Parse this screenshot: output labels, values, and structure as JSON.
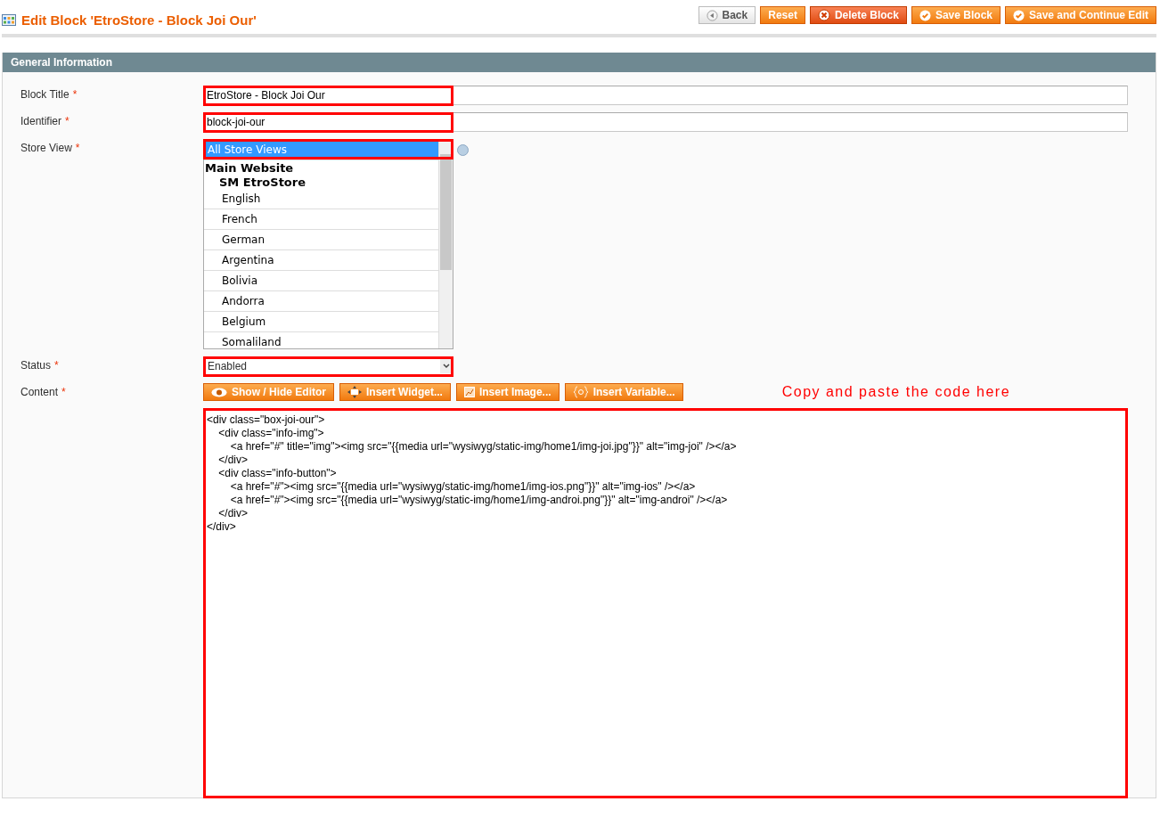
{
  "page_title": "Edit Block 'EtroStore - Block Joi Our'",
  "actions": [
    {
      "label": "Back",
      "kind": "back"
    },
    {
      "label": "Reset",
      "kind": "plain"
    },
    {
      "label": "Delete Block",
      "kind": "delete"
    },
    {
      "label": "Save Block",
      "kind": "save"
    },
    {
      "label": "Save and Continue Edit",
      "kind": "save"
    }
  ],
  "section": {
    "title": "General Information"
  },
  "fields": [
    {
      "label": "Block Title",
      "required_mark": "*",
      "kind": "text",
      "value": "EtroStore - Block Joi Our",
      "highlight": true
    },
    {
      "label": "Identifier",
      "required_mark": "*",
      "kind": "text",
      "value": "block-joi-our",
      "highlight": true
    },
    {
      "label": "Store View",
      "required_mark": "*",
      "kind": "multiselect",
      "highlight": true,
      "options": [
        {
          "label": "All Store Views",
          "selected": true
        },
        {
          "label": "Main Website",
          "kind": "group",
          "children": [
            {
              "label": "SM EtroStore",
              "kind": "group",
              "children": [
                {
                  "label": "English",
                  "selected": false
                },
                {
                  "label": "French",
                  "selected": false
                },
                {
                  "label": "German",
                  "selected": false
                },
                {
                  "label": "Argentina",
                  "selected": false
                },
                {
                  "label": "Bolivia",
                  "selected": false
                },
                {
                  "label": "Andorra",
                  "selected": false
                },
                {
                  "label": "Belgium",
                  "selected": false
                },
                {
                  "label": "Somaliland",
                  "selected": false
                }
              ]
            }
          ]
        }
      ]
    },
    {
      "label": "Status",
      "required_mark": "*",
      "kind": "select",
      "value": "Enabled",
      "highlight": true
    },
    {
      "label": "Content",
      "required_mark": "*",
      "kind": "editor",
      "highlight": true,
      "buttons": [
        {
          "label": "Show / Hide Editor",
          "kind": "eye"
        },
        {
          "label": "Insert Widget...",
          "kind": "widget"
        },
        {
          "label": "Insert Image...",
          "kind": "image"
        },
        {
          "label": "Insert Variable...",
          "kind": "variable"
        }
      ],
      "note": "Copy and paste the code here",
      "value": "<div class=\"box-joi-our\">\n\t<div class=\"info-img\">\n\t\t<a href=\"#\" title=\"img\"><img src=\"{{media url=\"wysiwyg/static-img/home1/img-joi.jpg\"}}\" alt=\"img-joi\" /></a>\n\t</div>\n\t<div class=\"info-button\">\n\t\t<a href=\"#\"><img src=\"{{media url=\"wysiwyg/static-img/home1/img-ios.png\"}}\" alt=\"img-ios\" /></a>\n\t\t<a href=\"#\"><img src=\"{{media url=\"wysiwyg/static-img/home1/img-androi.png\"}}\" alt=\"img-androi\" /></a>\n\t</div>\n</div>"
    }
  ]
}
